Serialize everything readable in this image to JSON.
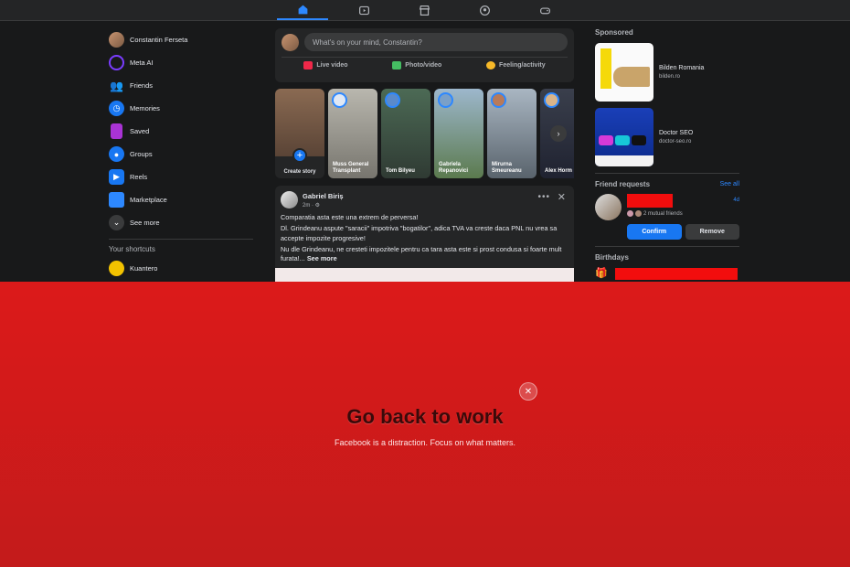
{
  "nav": {
    "icons": [
      "home-icon",
      "video-icon",
      "marketplace-icon",
      "groups-icon",
      "gaming-icon"
    ],
    "active": "home-icon"
  },
  "sidebar": {
    "items": [
      {
        "label": "Constantin Ferseta",
        "icon": "profile-avatar",
        "color": "#b98866"
      },
      {
        "label": "Meta AI",
        "icon": "meta-ai-icon",
        "color": "#7a3cff"
      },
      {
        "label": "Friends",
        "icon": "friends-icon",
        "color": "#1d9bf0"
      },
      {
        "label": "Memories",
        "icon": "memories-icon",
        "color": "#1877f2"
      },
      {
        "label": "Saved",
        "icon": "saved-icon",
        "color": "#a933d4"
      },
      {
        "label": "Groups",
        "icon": "groups-icon",
        "color": "#1877f2"
      },
      {
        "label": "Reels",
        "icon": "reels-icon",
        "color": "#1877f2"
      },
      {
        "label": "Marketplace",
        "icon": "marketplace-icon",
        "color": "#2d88ff"
      },
      {
        "label": "See more",
        "icon": "chevron-down-icon",
        "color": "#3a3b3c"
      }
    ],
    "shortcuts_title": "Your shortcuts",
    "shortcuts": [
      {
        "label": "Kuantero",
        "icon": "kuantero-icon",
        "color": "#f2c200"
      }
    ]
  },
  "composer": {
    "placeholder": "What's on your mind, Constantin?",
    "actions": [
      {
        "label": "Live video",
        "color": "#f02849"
      },
      {
        "label": "Photo/video",
        "color": "#45bd62"
      },
      {
        "label": "Feeling/activity",
        "color": "#f7b928"
      }
    ]
  },
  "stories": {
    "create_label": "Create story",
    "items": [
      {
        "name": "Muss General Transplant",
        "bg": "#9a9a92"
      },
      {
        "name": "Tom Bilyeu",
        "bg": "#4a5a4a"
      },
      {
        "name": "Gabriela Repanovici",
        "bg": "#5b7a5e"
      },
      {
        "name": "Mirurna Smeureanu",
        "bg": "#7c8a96"
      },
      {
        "name": "Alex Horm",
        "bg": "#2a2e3a"
      }
    ]
  },
  "post": {
    "author": "Gabriel Biriș",
    "time": "2m · ⚙",
    "paragraphs": [
      "Comparatia asta este una extrem de perversa!",
      "Dl. Grindeanu aspute \"saracii\" impotriva \"bogatilor\", adica TVA va creste daca PNL nu vrea sa accepte impozite progresive!",
      "Nu dle Grindeanu, ne cresteti impozitele pentru ca tara asta este si prost condusa si foarte mult furata!..."
    ],
    "see_more": "See more"
  },
  "right": {
    "sponsored_title": "Sponsored",
    "ads": [
      {
        "name": "Bilden Romania",
        "url": "bilden.ro"
      },
      {
        "name": "Doctor SEO",
        "url": "doctor-seo.ro"
      }
    ],
    "friend_requests": {
      "title": "Friend requests",
      "see_all": "See all",
      "age": "4d",
      "mutual": "2 mutual friends",
      "confirm": "Confirm",
      "remove": "Remove"
    },
    "birthdays_title": "Birthdays",
    "redaction_color": "#f20d0d"
  },
  "overlay": {
    "title": "Go back to work",
    "subtitle": "Facebook is a distraction. Focus on what matters.",
    "close": "✕"
  }
}
